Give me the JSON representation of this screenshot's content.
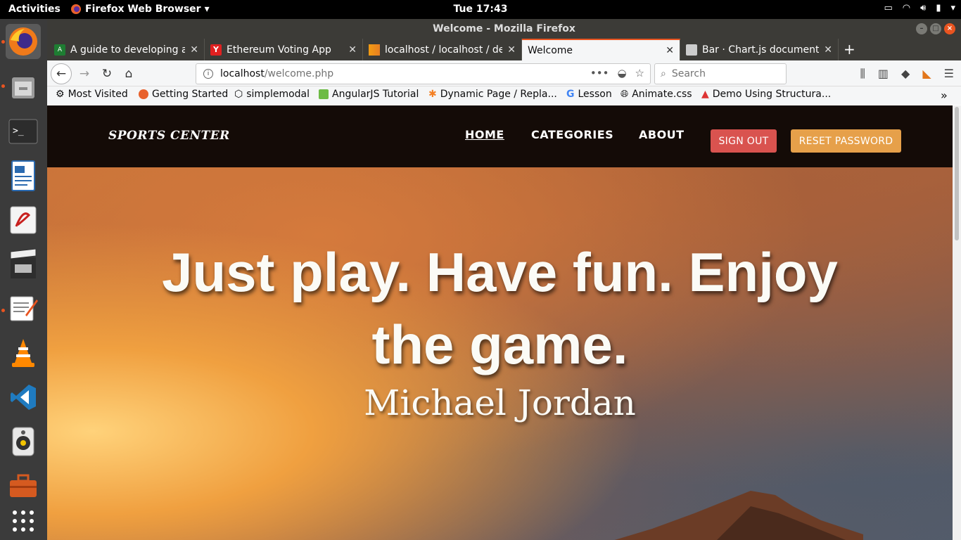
{
  "topbar": {
    "activities": "Activities",
    "app_menu": "Firefox Web Browser",
    "clock": "Tue 17:43"
  },
  "dock": {
    "items": [
      "firefox-icon",
      "files-icon",
      "terminal-icon",
      "writer-icon",
      "evince-icon",
      "video-icon",
      "text-editor-icon",
      "vlc-icon",
      "vscode-icon",
      "speaker-icon",
      "toolbox-icon",
      "app-grid-icon"
    ]
  },
  "window": {
    "title": "Welcome - Mozilla Firefox"
  },
  "tabs": [
    {
      "label": "A guide to developing an"
    },
    {
      "label": "Ethereum Voting App"
    },
    {
      "label": "localhost / localhost / de"
    },
    {
      "label": "Welcome"
    },
    {
      "label": "Bar · Chart.js documenta"
    }
  ],
  "urlbar": {
    "host": "localhost",
    "path": "/welcome.php"
  },
  "search": {
    "placeholder": "Search"
  },
  "bookmarks": [
    {
      "label": "Most Visited"
    },
    {
      "label": "Getting Started"
    },
    {
      "label": "simplemodal"
    },
    {
      "label": "AngularJS Tutorial"
    },
    {
      "label": "Dynamic Page / Repla..."
    },
    {
      "label": "Lesson"
    },
    {
      "label": "Animate.css"
    },
    {
      "label": "Demo Using Structura..."
    }
  ],
  "site": {
    "brand": "SPORTS CENTER",
    "nav": {
      "home": "HOME",
      "categories": "CATEGORIES",
      "about": "ABOUT"
    },
    "signout": "SIGN OUT",
    "reset_password": "RESET PASSWORD",
    "quote_line1": "Just play. Have fun. Enjoy",
    "quote_line2": "the game.",
    "author": "Michael Jordan"
  },
  "colors": {
    "accent": "#e95420",
    "signout": "#d9534f",
    "reset": "#e6a04a",
    "navbar": "#140b07"
  }
}
